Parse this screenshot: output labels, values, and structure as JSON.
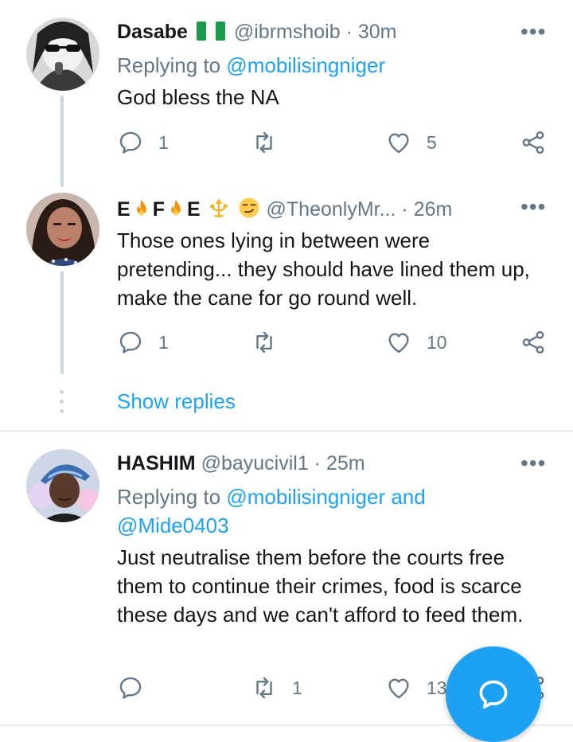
{
  "colors": {
    "accent": "#1da1f2",
    "muted": "#657786",
    "text": "#14171a",
    "divider": "#e6ecf0"
  },
  "tweets": [
    {
      "name": "Dasabe",
      "name_flag": "nigeria-flag",
      "handle": "@ibrmshoib",
      "dot": "·",
      "time": "30m",
      "replying_prefix": "Replying to",
      "replying_mentions": "@mobilisingniger",
      "text": "God bless the NA",
      "reply_count": "1",
      "retweet_count": "",
      "like_count": "5"
    },
    {
      "name_parts": [
        "E",
        "F",
        "E"
      ],
      "handle": "@TheonlyMr...",
      "dot": "·",
      "time": "26m",
      "text": "Those ones lying in between were pretending... they should have lined them up, make the cane for go round well.",
      "reply_count": "1",
      "retweet_count": "",
      "like_count": "10",
      "show_replies": "Show replies"
    },
    {
      "name": "HASHIM",
      "handle": "@bayucivil1",
      "dot": "·",
      "time": "25m",
      "replying_prefix": "Replying to",
      "replying_mentions": "@mobilisingniger and",
      "replying_mentions_2": "@Mide0403",
      "text": "Just neutralise them before the courts free them to continue their crimes, food is scarce these days and we can't afford to feed them.",
      "reply_count": "",
      "retweet_count": "1",
      "like_count": "13"
    }
  ],
  "icons": {
    "reply": "reply-icon",
    "retweet": "retweet-icon",
    "like": "heart-icon",
    "share": "share-icon",
    "more": "more-icon",
    "compose": "compose-reply-icon"
  },
  "more_glyph": "•••"
}
